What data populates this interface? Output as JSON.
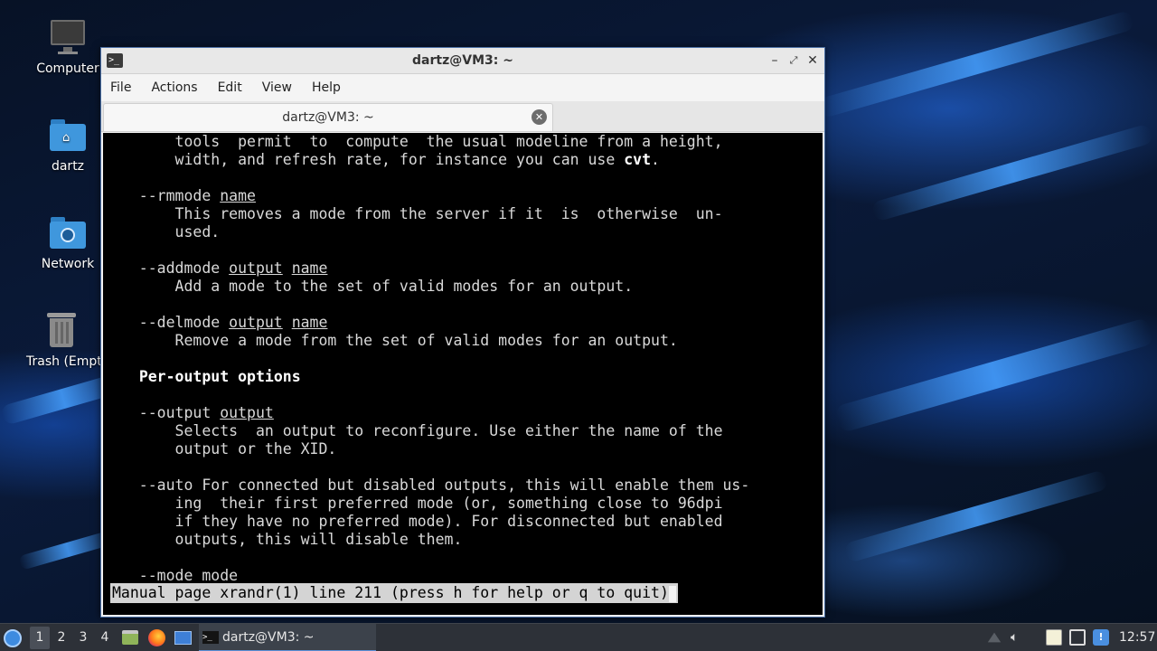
{
  "desktop": {
    "icons": [
      {
        "label": "Computer",
        "icon": "monitor-icon"
      },
      {
        "label": "dartz",
        "icon": "home-folder-icon"
      },
      {
        "label": "Network",
        "icon": "network-folder-icon"
      },
      {
        "label": "Trash (Empty)",
        "icon": "trash-icon"
      }
    ]
  },
  "window": {
    "title": "dartz@VM3: ~",
    "menus": [
      "File",
      "Actions",
      "Edit",
      "View",
      "Help"
    ],
    "tab": {
      "label": "dartz@VM3: ~"
    },
    "terminal": {
      "lines": [
        [
          {
            "t": "       tools  permit  to  compute  the usual modeline from a height,"
          }
        ],
        [
          {
            "t": "       width, and refresh rate, for instance you can use "
          },
          {
            "t": "cvt",
            "s": "b"
          },
          {
            "t": "."
          }
        ],
        [
          {
            "t": ""
          }
        ],
        [
          {
            "t": "   --rmmode "
          },
          {
            "t": "name",
            "s": "u"
          }
        ],
        [
          {
            "t": "       This removes a mode from the server if it  is  otherwise  un-"
          }
        ],
        [
          {
            "t": "       used."
          }
        ],
        [
          {
            "t": ""
          }
        ],
        [
          {
            "t": "   --addmode "
          },
          {
            "t": "output",
            "s": "u"
          },
          {
            "t": " "
          },
          {
            "t": "name",
            "s": "u"
          }
        ],
        [
          {
            "t": "       Add a mode to the set of valid modes for an output."
          }
        ],
        [
          {
            "t": ""
          }
        ],
        [
          {
            "t": "   --delmode "
          },
          {
            "t": "output",
            "s": "u"
          },
          {
            "t": " "
          },
          {
            "t": "name",
            "s": "u"
          }
        ],
        [
          {
            "t": "       Remove a mode from the set of valid modes for an output."
          }
        ],
        [
          {
            "t": ""
          }
        ],
        [
          {
            "t": "   "
          },
          {
            "t": "Per-output options",
            "s": "b"
          }
        ],
        [
          {
            "t": ""
          }
        ],
        [
          {
            "t": "   --output "
          },
          {
            "t": "output",
            "s": "u"
          }
        ],
        [
          {
            "t": "       Selects  an output to reconfigure. Use either the name of the"
          }
        ],
        [
          {
            "t": "       output or the XID."
          }
        ],
        [
          {
            "t": ""
          }
        ],
        [
          {
            "t": "   --auto For connected but disabled outputs, this will enable them us-"
          }
        ],
        [
          {
            "t": "       ing  their first preferred mode (or, something close to 96dpi"
          }
        ],
        [
          {
            "t": "       if they have no preferred mode). For disconnected but enabled"
          }
        ],
        [
          {
            "t": "       outputs, this will disable them."
          }
        ],
        [
          {
            "t": ""
          }
        ],
        [
          {
            "t": "   --mode mode"
          }
        ]
      ],
      "status": "Manual page xrandr(1) line 211 (press h for help or q to quit)"
    }
  },
  "taskbar": {
    "workspaces": [
      "1",
      "2",
      "3",
      "4"
    ],
    "active_workspace": "1",
    "launchers": [
      "file-manager-icon",
      "firefox-icon",
      "desktop-icon"
    ],
    "task_label": "dartz@VM3: ~",
    "clock": "12:57",
    "tray": [
      "volume-icon",
      "clipboard-icon",
      "display-icon",
      "notification-icon"
    ]
  },
  "colors": {
    "accent": "#5b8fd6",
    "terminal_bg": "#000000",
    "window_border": "#4a6fa5"
  }
}
